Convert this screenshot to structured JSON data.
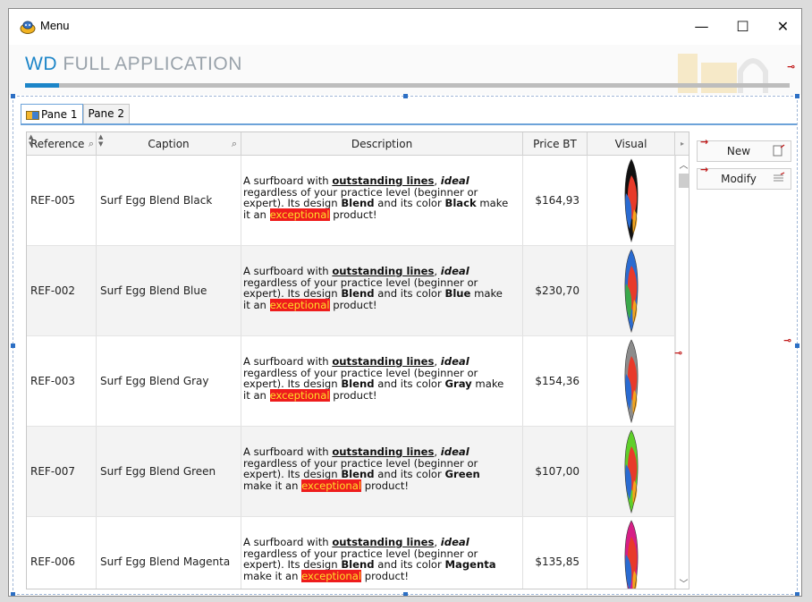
{
  "window": {
    "title": "Menu",
    "controls": {
      "minimize": "—",
      "maximize": "☐",
      "close": "✕"
    }
  },
  "header": {
    "brand": "WD",
    "title_rest": " FULL APPLICATION",
    "progress": 0.045
  },
  "tabs": [
    {
      "label": "Pane 1",
      "active": true
    },
    {
      "label": "Pane 2",
      "active": false
    }
  ],
  "table": {
    "columns": [
      "Reference",
      "Caption",
      "Description",
      "Price BT",
      "Visual"
    ],
    "rows": [
      {
        "reference": "REF-005",
        "caption": "Surf Egg Blend Black",
        "color": "Black",
        "price": "$164,93",
        "board_colors": [
          "#111111",
          "#e83a2a",
          "#2a6bd1",
          "#f4a51c"
        ]
      },
      {
        "reference": "REF-002",
        "caption": "Surf Egg Blend Blue",
        "color": "Blue",
        "price": "$230,70",
        "board_colors": [
          "#2a6bd1",
          "#e83a2a",
          "#3aa84a",
          "#f4a51c"
        ]
      },
      {
        "reference": "REF-003",
        "caption": "Surf Egg Blend Gray",
        "color": "Gray",
        "price": "$154,36",
        "board_colors": [
          "#8c8c8c",
          "#e83a2a",
          "#2a6bd1",
          "#f4a51c"
        ]
      },
      {
        "reference": "REF-007",
        "caption": "Surf Egg Blend Green",
        "color": "Green",
        "price": "$107,00",
        "board_colors": [
          "#5fcf2a",
          "#e83a2a",
          "#2a6bd1",
          "#f4a51c"
        ]
      },
      {
        "reference": "REF-006",
        "caption": "Surf Egg Blend Magenta",
        "color": "Magenta",
        "price": "$135,85",
        "board_colors": [
          "#d61f86",
          "#e83a2a",
          "#2a6bd1",
          "#f4a51c"
        ]
      }
    ],
    "description": {
      "part1": "A surfboard with ",
      "strong1": "outstanding lines",
      "part2": ", ",
      "em1": "ideal",
      "part3": " regardless of your practice level (beginner or expert). Its design ",
      "strong2": "Blend",
      "part4": " and its color ",
      "part5": " make it an ",
      "highlight": "exceptional",
      "part6": " product!"
    }
  },
  "actions": {
    "new_label": "New",
    "modify_label": "Modify"
  },
  "colors": {
    "accent": "#1c85c8",
    "highlight_bg": "#ee1c1c",
    "highlight_fg": "#ffde2a",
    "anchor": "#c01818"
  }
}
